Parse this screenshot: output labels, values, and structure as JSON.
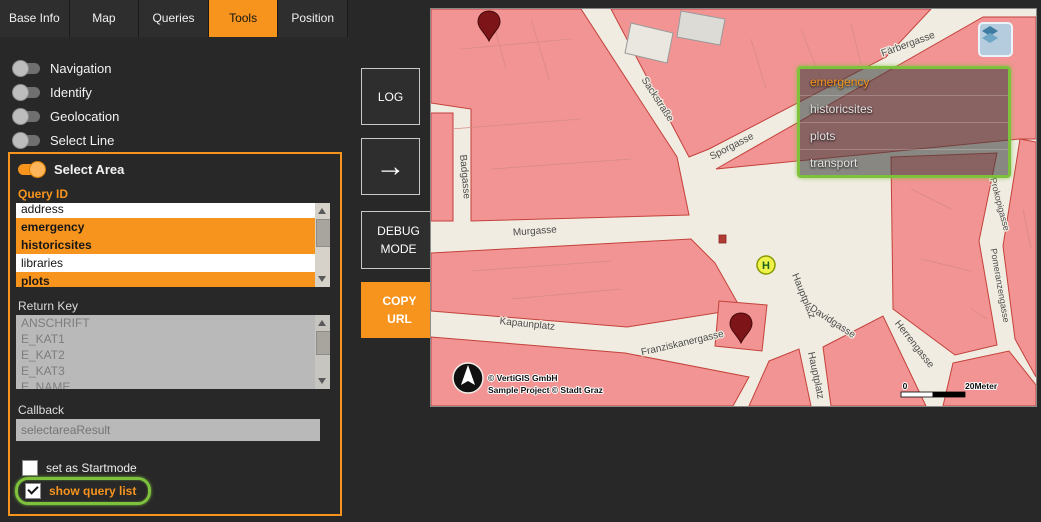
{
  "colors": {
    "accent": "#f7941e",
    "highlight_green": "#7dc13d"
  },
  "tabs": {
    "items": [
      {
        "label": "Base Info",
        "active": false
      },
      {
        "label": "Map",
        "active": false
      },
      {
        "label": "Queries",
        "active": false
      },
      {
        "label": "Tools",
        "active": true
      },
      {
        "label": "Position",
        "active": false
      }
    ]
  },
  "panel": {
    "toggles": [
      {
        "label": "Navigation",
        "on": false
      },
      {
        "label": "Identify",
        "on": false
      },
      {
        "label": "Geolocation",
        "on": false
      },
      {
        "label": "Select Line",
        "on": false
      }
    ],
    "select_area": {
      "label": "Select Area",
      "on": true,
      "query_id_label": "Query ID",
      "query_options": [
        {
          "label": "address",
          "selected": false
        },
        {
          "label": "emergency",
          "selected": true
        },
        {
          "label": "historicsites",
          "selected": true
        },
        {
          "label": "libraries",
          "selected": false
        },
        {
          "label": "plots",
          "selected": true
        }
      ],
      "return_key_label": "Return Key",
      "return_key_options": [
        {
          "label": "ANSCHRIFT"
        },
        {
          "label": "E_KAT1"
        },
        {
          "label": "E_KAT2"
        },
        {
          "label": "E_KAT3"
        },
        {
          "label": "E_NAME"
        }
      ],
      "callback_label": "Callback",
      "callback_value": "selectareaResult",
      "startmode": {
        "label": "set as Startmode",
        "checked": false
      },
      "querylist": {
        "label": "show query list",
        "checked": true
      }
    }
  },
  "actions": {
    "log": "LOG",
    "arrow_icon": "→",
    "debug": "DEBUG MODE",
    "copy_url": "COPY URL"
  },
  "map": {
    "overlay": {
      "items": [
        {
          "label": "emergency",
          "highlighted": true
        },
        {
          "label": "historicsites",
          "highlighted": false
        },
        {
          "label": "plots",
          "highlighted": false
        },
        {
          "label": "transport",
          "highlighted": false
        }
      ]
    },
    "attribution": {
      "line1": "© VertiGIS GmbH",
      "line2": "Sample Project © Stadt Graz"
    },
    "scale": {
      "zero": "0",
      "label": "20Meter"
    },
    "transit_stop": "H",
    "streets": {
      "sackstrasse": "Sackstraße",
      "sporgasse": "Sporgasse",
      "badgasse": "Badgasse",
      "murgasse": "Murgasse",
      "prokopigasse": "Prokopigasse",
      "pomeranzengasse": "Pomeranzengasse",
      "hauptplatz1": "Hauptplatz",
      "davidgasse": "Davidgasse",
      "kapaunplatz": "Kapaunplatz",
      "franziskanergasse": "Franziskanergasse",
      "herrengasse": "Herrengasse",
      "hauptplatz2": "Hauptplatz",
      "faerbergasse": "Färbergasse"
    }
  }
}
